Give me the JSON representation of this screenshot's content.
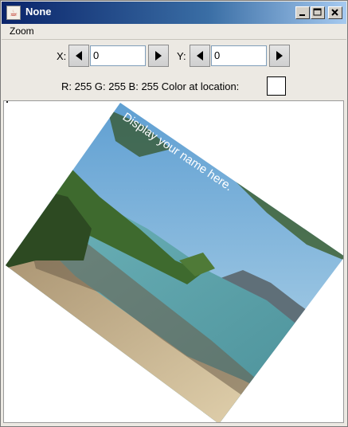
{
  "window": {
    "title": "None",
    "app_icon": "java-cup-icon"
  },
  "title_buttons": {
    "minimize_icon": "minimize-icon",
    "maximize_icon": "maximize-icon",
    "close_icon": "close-icon"
  },
  "menu": {
    "zoom": "Zoom"
  },
  "coords": {
    "x_label": "X:",
    "x_value": "0",
    "y_label": "Y:",
    "y_value": "0"
  },
  "color_info": {
    "text": "R: 255 G: 255 B: 255 Color at location:",
    "swatch_color": "#ffffff"
  },
  "image": {
    "overlay_text": "Display your name here."
  }
}
